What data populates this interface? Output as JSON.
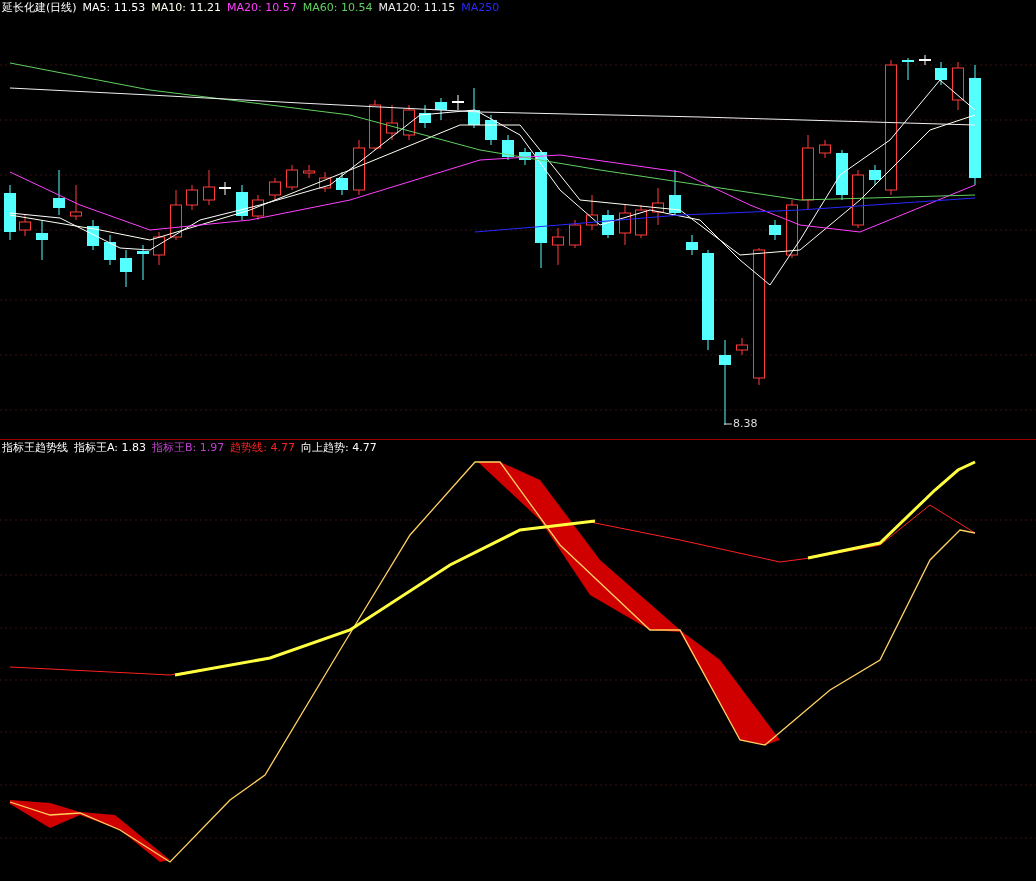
{
  "price_panel": {
    "title": "延长化建(日线)",
    "legend": [
      {
        "label": "MA5: 11.53",
        "color": "#ffffff"
      },
      {
        "label": "MA10: 11.21",
        "color": "#fffff0"
      },
      {
        "label": "MA20: 10.57",
        "color": "#ff40ff"
      },
      {
        "label": "MA60: 10.54",
        "color": "#60d060"
      },
      {
        "label": "MA120: 11.15",
        "color": "#f0f0f0"
      },
      {
        "label": "MA250",
        "color": "#2828ff"
      }
    ],
    "low_label": "8.38"
  },
  "indicator_panel": {
    "title": "指标王趋势线",
    "legend": [
      {
        "label": "指标王A: 1.83",
        "color": "#ffffff"
      },
      {
        "label": "指标王B: 1.97",
        "color": "#c040d0"
      },
      {
        "label": "趋势线: 4.77",
        "color": "#ff2020"
      },
      {
        "label": "向上趋势: 4.77",
        "color": "#f8f8f8"
      }
    ]
  }
}
